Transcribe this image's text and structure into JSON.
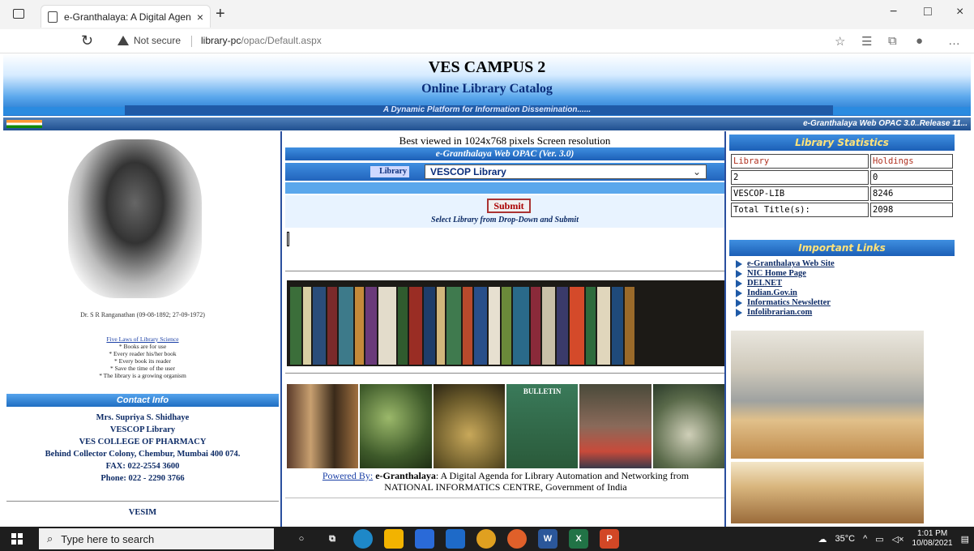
{
  "browser": {
    "tab_title": "e-Granthalaya: A Digital Agenda",
    "tab_close": "×",
    "new_tab": "+",
    "security_label": "Not secure",
    "url_host": "library-pc",
    "url_path": "/opac/Default.aspx",
    "window_controls": [
      "−",
      "□",
      "×"
    ]
  },
  "banner": {
    "title": "VES CAMPUS 2",
    "subtitle": "Online Library Catalog",
    "tagline": "A Dynamic Platform for Information Dissemination......",
    "release": "e-Granthalaya Web OPAC 3.0..Release 11..."
  },
  "left": {
    "portrait_caption": "Dr. S R Ranganathan (09-08-1892; 27-09-1972)",
    "laws_title": "Five Laws of Library Science",
    "laws": [
      "* Books are for use",
      "* Every reader his/her book",
      "* Every book its reader",
      "* Save the time of the user",
      "* The library is a growing organism"
    ],
    "contact_heading": "Contact Info",
    "contact_lines": [
      "Mrs. Supriya S. Shidhaye",
      "VESCOP Library",
      "VES COLLEGE OF PHARMACY",
      "Behind Collector Colony, Chembur, Mumbai 400 074.",
      "FAX: 022-2554 3600",
      "Phone: 022 - 2290 3766"
    ],
    "vesim": "VESIM"
  },
  "center": {
    "best_viewed": "Best viewed in 1024x768 pixels Screen resolution",
    "opac_title": "e-Granthalaya Web OPAC (Ver. 3.0)",
    "library_label": "Library",
    "library_selected": "VESCOP Library",
    "submit_label": "Submit",
    "hint": "Select Library from Drop-Down and Submit",
    "bulletin_label": "BULLETIN",
    "powered_by": "Powered By:",
    "powered_name": "e-Granthalaya",
    "powered_rest": ": A Digital Agenda for Library Automation and Networking from",
    "powered_line2": "NATIONAL INFORMATICS CENTRE, Government of India"
  },
  "right": {
    "stats_heading": "Library Statistics",
    "stats_header": [
      "Library",
      "Holdings"
    ],
    "stats_rows": [
      [
        "2",
        "0"
      ],
      [
        "VESCOP-LIB",
        "8246"
      ],
      [
        "Total Title(s):",
        "2098"
      ]
    ],
    "links_heading": "Important Links",
    "links": [
      "e-Granthalaya Web Site",
      "NIC Home Page",
      "DELNET",
      "Indian.Gov.in",
      "Informatics Newsletter",
      "Infolibrarian.com"
    ]
  },
  "taskbar": {
    "search_placeholder": "Type here to search",
    "temperature": "35°C",
    "time": "1:01 PM",
    "date": "10/08/2021"
  },
  "colors": {
    "banner_blue": "#1b6fc9",
    "section_bar": "#1f6ec2",
    "heading_yellow": "#ffe37a",
    "link_navy": "#0d2b66",
    "submit_red": "#a00000"
  }
}
